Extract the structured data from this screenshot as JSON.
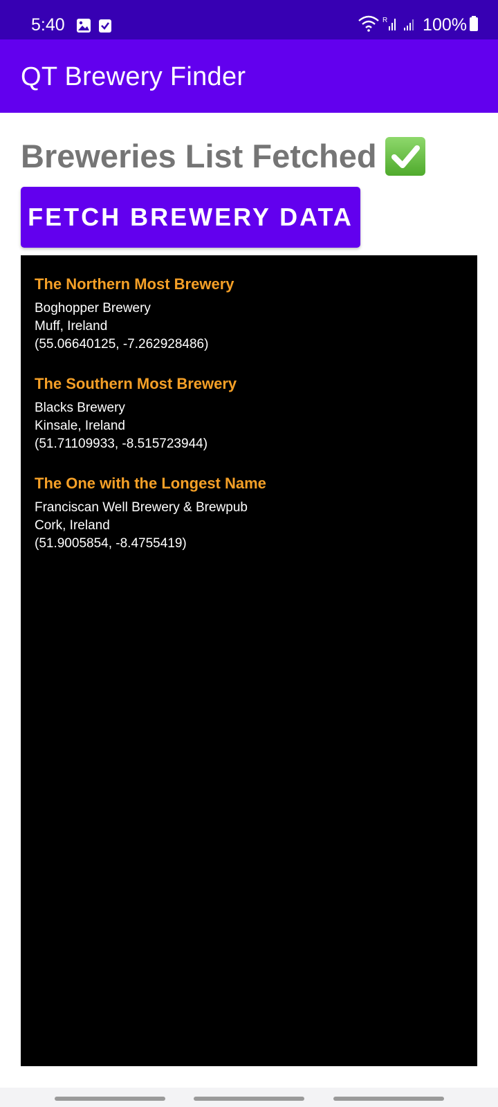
{
  "status_bar": {
    "time": "5:40",
    "left_icons": [
      "image-icon",
      "check-box-icon"
    ],
    "right_icons": [
      "wifi-icon",
      "signal-icon",
      "signal-icon-2",
      "battery-icon"
    ],
    "battery_percent": "100%"
  },
  "app_bar": {
    "title": "QT Brewery Finder"
  },
  "heading": {
    "text": "Breweries List Fetched"
  },
  "fetch_button": {
    "label": "FETCH BREWERY DATA"
  },
  "results": [
    {
      "title": "The Northern Most Brewery",
      "name": "Boghopper Brewery",
      "location": "Muff, Ireland",
      "coordinates": "(55.06640125, -7.262928486)"
    },
    {
      "title": "The Southern Most Brewery",
      "name": "Blacks Brewery",
      "location": "Kinsale, Ireland",
      "coordinates": "(51.71109933, -8.515723944)"
    },
    {
      "title": "The One with the Longest Name",
      "name": "Franciscan Well Brewery & Brewpub",
      "location": "Cork, Ireland",
      "coordinates": "(51.9005854, -8.4755419)"
    }
  ],
  "colors": {
    "status_bar": "#3700B3",
    "app_bar": "#6200EE",
    "button": "#6200EE",
    "heading_text": "#757575",
    "entry_title": "#F5A027",
    "panel": "#000000"
  }
}
